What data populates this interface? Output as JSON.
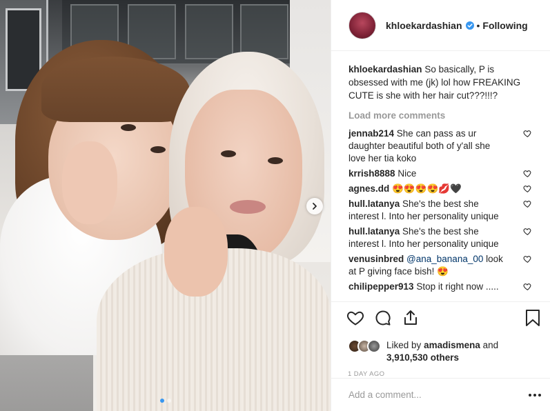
{
  "post": {
    "username": "khloekardashian",
    "follow_separator": "•",
    "follow_label": "Following",
    "caption": "So basically, P is obsessed with me (jk) lol how FREAKING CUTE is she with her hair cut???!!!?",
    "load_more_label": "Load more comments",
    "slides_total": 2,
    "slide_active": 1
  },
  "comments": [
    {
      "user": "jennab214",
      "text": "She can pass as ur daughter beautiful both of y'all she love her tia koko"
    },
    {
      "user": "krrish8888",
      "text": "Nice"
    },
    {
      "user": "agnes.dd",
      "text": "😍😍😍😍💋🖤"
    },
    {
      "user": "hull.latanya",
      "text": "She's the best she interest l. Into her personality unique"
    },
    {
      "user": "hull.latanya",
      "text": "She's the best she interest l. Into her personality unique"
    },
    {
      "user": "venusinbred",
      "mention": "@ana_banana_00",
      "text": "look at P giving face bish! 😍"
    },
    {
      "user": "chilipepper913",
      "text": "Stop it right now ....."
    }
  ],
  "likes": {
    "prefix": "Liked by",
    "user": "amadismena",
    "connector": "and",
    "count": "3,910,530 others"
  },
  "timestamp": "1 DAY AGO",
  "add_comment": {
    "placeholder": "Add a comment..."
  },
  "colors": {
    "text": "#262626",
    "muted": "#999999",
    "border": "#efefef",
    "verified": "#3897f0",
    "mention": "#003569"
  },
  "icons": {
    "like": "heart-outline-icon",
    "comment": "speech-bubble-icon",
    "share": "share-upload-icon",
    "save": "bookmark-icon",
    "more": "more-dots-icon",
    "verified": "verified-badge-icon",
    "next": "chevron-right-icon"
  }
}
